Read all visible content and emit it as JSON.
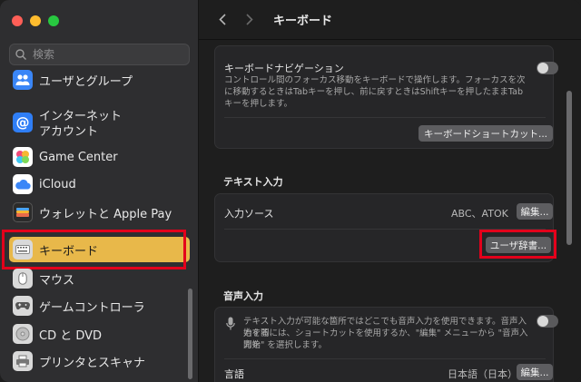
{
  "search": {
    "placeholder": "検索"
  },
  "sidebar": {
    "items": [
      {
        "label": "ユーザとグループ"
      },
      {
        "label": "インターネット"
      },
      {
        "label": "アカウント"
      },
      {
        "label": "Game Center"
      },
      {
        "label": "iCloud"
      },
      {
        "label": "ウォレットと Apple Pay"
      },
      {
        "label": "キーボード"
      },
      {
        "label": "マウス"
      },
      {
        "label": "ゲームコントローラ"
      },
      {
        "label": "CD と DVD"
      },
      {
        "label": "プリンタとスキャナ"
      }
    ]
  },
  "toolbar": {
    "title": "キーボード"
  },
  "keyboard_nav": {
    "label": "キーボードナビゲーション",
    "desc1": "コントロール間のフォーカス移動をキーボードで操作します。フォーカスを次",
    "desc2": "に移動するときはTabキーを押し、前に戻すときはShiftキーを押したままTab",
    "desc3": "キーを押します。",
    "shortcut_button": "キーボードショートカット..."
  },
  "text_input": {
    "section_title": "テキスト入力",
    "input_source_label": "入力ソース",
    "input_source_value": "ABC、ATOK",
    "edit_button": "編集...",
    "user_dict_button": "ユーザ辞書..."
  },
  "voice_input": {
    "section_title": "音声入力",
    "desc1": "テキスト入力が可能な箇所ではどこでも音声入力を使用できます。音声入力を開",
    "desc2": "始するには、ショートカットを使用するか、\"編集\" メニューから \"音声入力を",
    "desc3": "開始\" を選択します。",
    "language_label": "言語",
    "language_value": "日本語（日本）",
    "edit_button": "編集..."
  },
  "colors": {
    "accent_selected": "#e8b84a",
    "highlight": "#e3001b"
  }
}
